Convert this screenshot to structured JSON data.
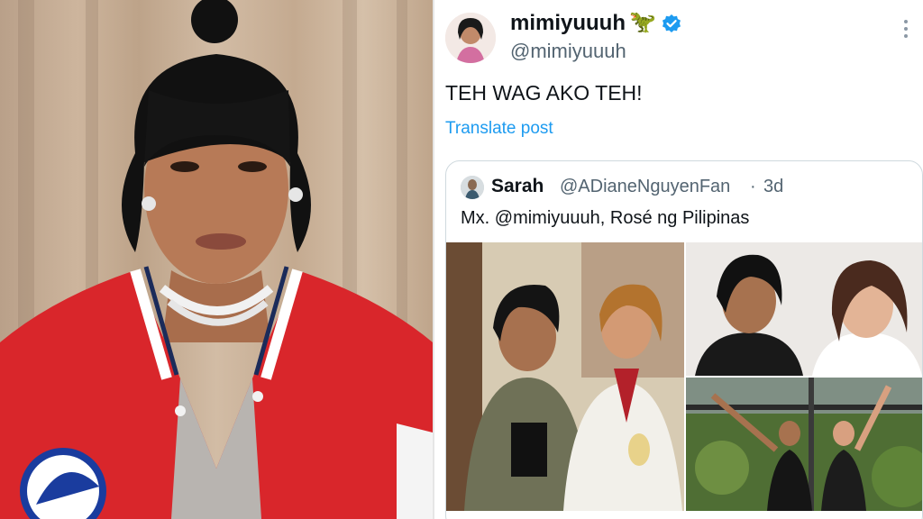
{
  "images": {
    "left_photo": "portrait-photo",
    "media_1": "media-photo-1",
    "media_2": "media-photo-2",
    "media_3": "media-photo-3"
  },
  "post": {
    "display_name": "mimiyuuuh",
    "emoji": "🦖",
    "verified_icon": "verified-badge-icon",
    "handle": "@mimiyuuuh",
    "text": "TEH WAG AKO TEH!",
    "translate_label": "Translate post",
    "more_icon": "more-options-icon"
  },
  "quoted": {
    "name": "Sarah",
    "handle": "@ADianeNguyenFan",
    "separator": "·",
    "time": "3d",
    "text": "Mx. @mimiyuuuh, Rosé ng Pilipinas"
  },
  "colors": {
    "link_blue": "#1d9bf0",
    "verified_blue": "#1d9bf0",
    "text_primary": "#0f1419",
    "text_secondary": "#536471",
    "jacket_red": "#d9262b"
  }
}
